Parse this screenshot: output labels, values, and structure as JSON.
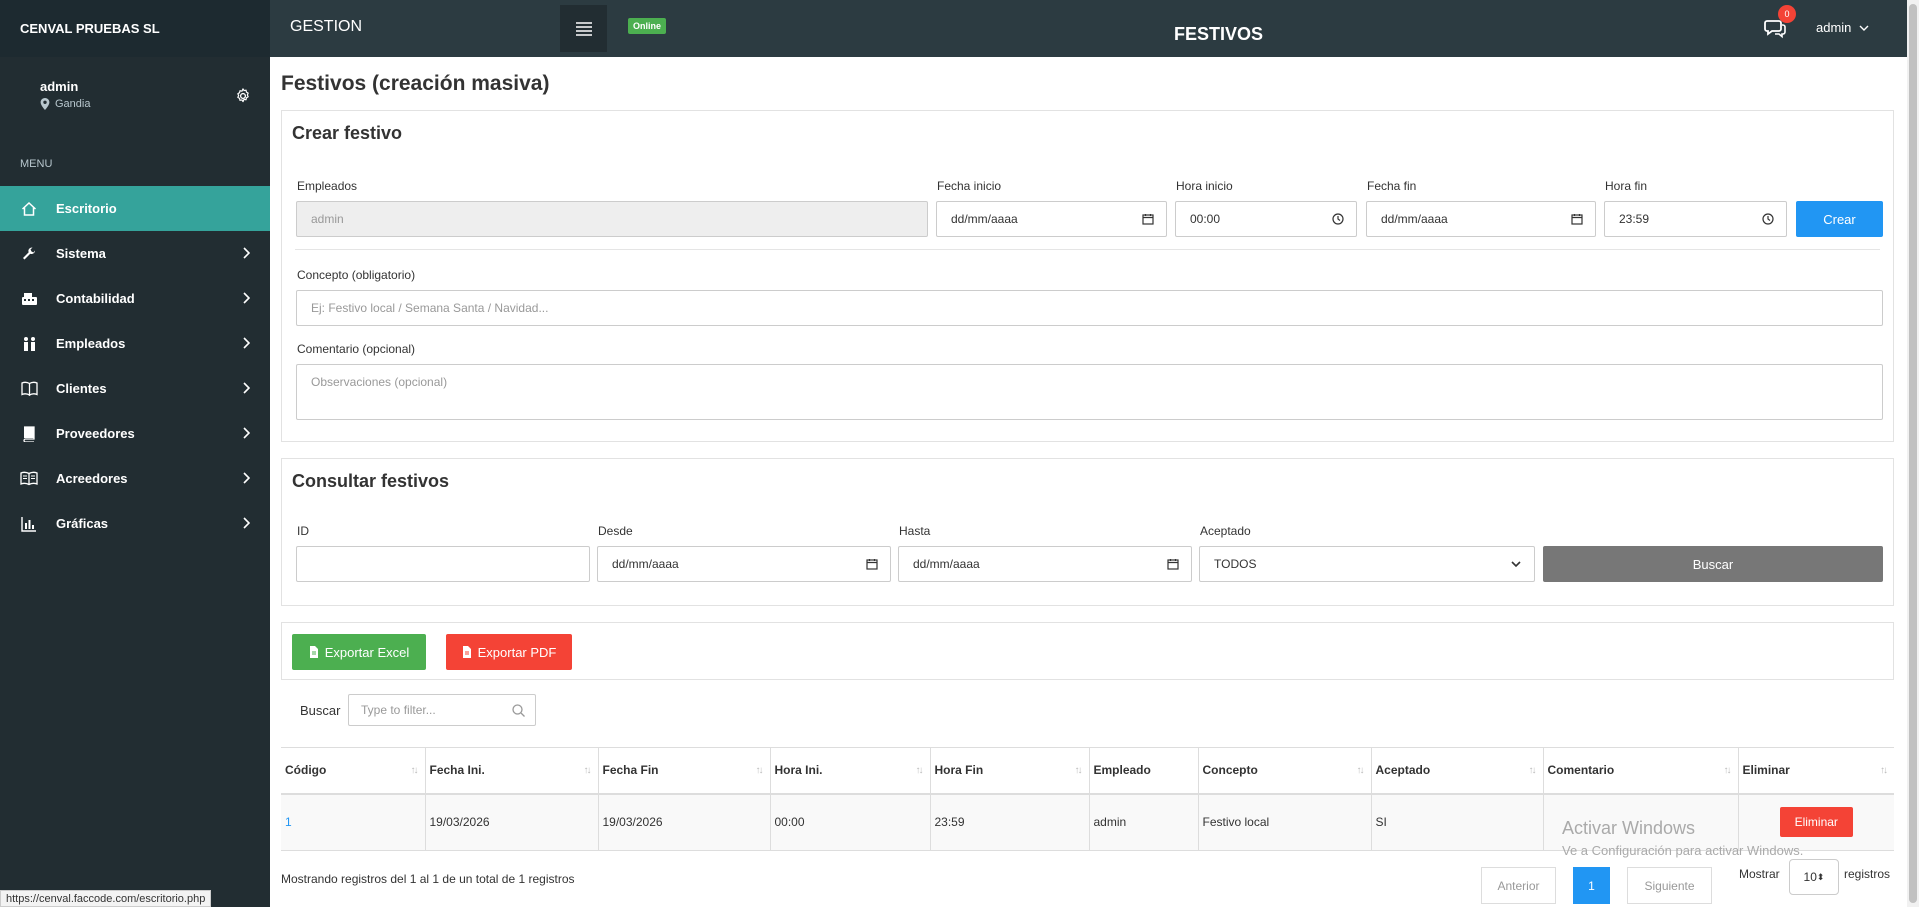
{
  "sidebar": {
    "brand": "CENVAL PRUEBAS SL",
    "user_name": "admin",
    "user_location": "Gandia",
    "menu_header": "MENU",
    "items": [
      {
        "label": "Escritorio"
      },
      {
        "label": "Sistema"
      },
      {
        "label": "Contabilidad"
      },
      {
        "label": "Empleados"
      },
      {
        "label": "Clientes"
      },
      {
        "label": "Proveedores"
      },
      {
        "label": "Acreedores"
      },
      {
        "label": "Gráficas"
      }
    ]
  },
  "topbar": {
    "app_name": "GESTION",
    "status_badge": "Online",
    "page_heading": "FESTIVOS",
    "notifications_count": "0",
    "user_label": "admin"
  },
  "content": {
    "title": "Festivos (creación masiva)"
  },
  "create_form": {
    "title": "Crear festivo",
    "empleados_label": "Empleados",
    "empleados_value": "admin",
    "fecha_inicio_label": "Fecha inicio",
    "fecha_inicio_value": "dd/mm/aaaa",
    "hora_inicio_label": "Hora inicio",
    "hora_inicio_value": "00:00",
    "fecha_fin_label": "Fecha fin",
    "fecha_fin_value": "dd/mm/aaaa",
    "hora_fin_label": "Hora fin",
    "hora_fin_value": "23:59",
    "crear_button": "Crear",
    "concepto_label": "Concepto (obligatorio)",
    "concepto_placeholder": "Ej: Festivo local / Semana Santa / Navidad...",
    "comentario_label": "Comentario (opcional)",
    "comentario_placeholder": "Observaciones (opcional)"
  },
  "query_form": {
    "title": "Consultar festivos",
    "id_label": "ID",
    "id_value": "",
    "desde_label": "Desde",
    "desde_value": "dd/mm/aaaa",
    "hasta_label": "Hasta",
    "hasta_value": "dd/mm/aaaa",
    "aceptado_label": "Aceptado",
    "aceptado_value": "TODOS",
    "buscar_button": "Buscar"
  },
  "export": {
    "excel_button": "Exportar Excel",
    "pdf_button": "Exportar PDF"
  },
  "table": {
    "filter_label": "Buscar",
    "filter_placeholder": "Type to filter...",
    "columns": [
      "Código",
      "Fecha Ini.",
      "Fecha Fin",
      "Hora Ini.",
      "Hora Fin",
      "Empleado",
      "Concepto",
      "Aceptado",
      "Comentario",
      "Eliminar"
    ],
    "rows": [
      {
        "codigo": "1",
        "fecha_ini": "19/03/2026",
        "fecha_fin": "19/03/2026",
        "hora_ini": "00:00",
        "hora_fin": "23:59",
        "empleado": "admin",
        "concepto": "Festivo local",
        "aceptado": "SI",
        "comentario": "",
        "eliminar": "Eliminar"
      }
    ],
    "info": "Mostrando registros del 1 al 1 de un total de 1 registros",
    "prev_label": "Anterior",
    "current_page": "1",
    "next_label": "Siguiente",
    "show_label": "Mostrar",
    "show_value": "10",
    "records_label": "registros"
  },
  "overlay": {
    "watermark_title": "Activar Windows",
    "watermark_sub": "Ve a Configuración para activar Windows.",
    "status_url": "https://cenval.faccode.com/escritorio.php"
  },
  "colors": {
    "sidebar_bg": "#222d32",
    "active_item": "#35a39b",
    "primary": "#2196f3",
    "success": "#4caf50",
    "danger": "#f44336"
  }
}
